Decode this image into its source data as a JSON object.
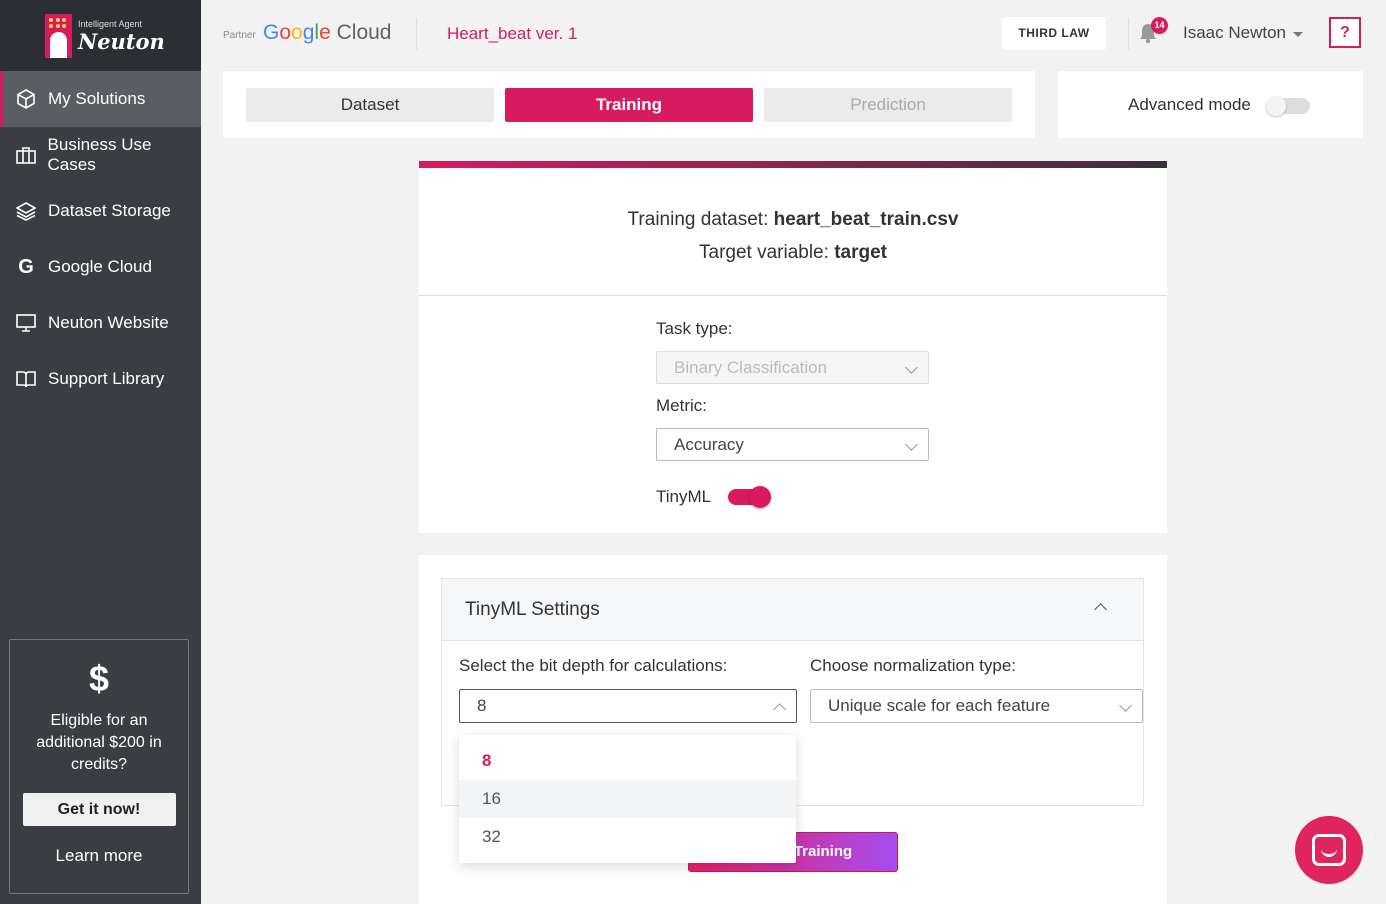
{
  "sidebar": {
    "logo": {
      "subtitle": "Intelligent Agent",
      "name": "Neuton"
    },
    "items": [
      {
        "label": "My Solutions",
        "icon": "cube-icon"
      },
      {
        "label": "Business Use Cases",
        "icon": "briefcase-icon"
      },
      {
        "label": "Dataset Storage",
        "icon": "layers-icon"
      },
      {
        "label": "Google Cloud",
        "icon": "google-g-icon"
      },
      {
        "label": "Neuton Website",
        "icon": "monitor-icon"
      },
      {
        "label": "Support Library",
        "icon": "book-icon"
      }
    ],
    "credit": {
      "symbol": "$",
      "text": "Eligible for an additional $200 in credits?",
      "button": "Get it now!",
      "link": "Learn more"
    }
  },
  "header": {
    "partner": "Partner",
    "brand": {
      "g": "G",
      "o1": "o",
      "o2": "o",
      "g2": "g",
      "l": "l",
      "e": "e",
      "cloud": "Cloud"
    },
    "project_title": "Heart_beat ver. 1",
    "org_button": "THIRD LAW",
    "notifications_count": "14",
    "user_name": "Isaac Newton",
    "help_label": "?"
  },
  "tabs": [
    {
      "label": "Dataset",
      "state": "default"
    },
    {
      "label": "Training",
      "state": "active"
    },
    {
      "label": "Prediction",
      "state": "disabled"
    }
  ],
  "advanced_mode": {
    "label": "Advanced mode",
    "enabled": false
  },
  "training": {
    "dataset_prefix": "Training dataset:",
    "dataset_name": "heart_beat_train.csv",
    "target_prefix": "Target variable:",
    "target_name": "target",
    "task_type_label": "Task type:",
    "task_type_value": "Binary Classification",
    "metric_label": "Metric:",
    "metric_value": "Accuracy",
    "tinyml_label": "TinyML",
    "tinyml_enabled": true
  },
  "tinyml_settings": {
    "title": "TinyML Settings",
    "bit_depth_label": "Select the bit depth for calculations:",
    "bit_depth_value": "8",
    "bit_depth_options": [
      "8",
      "16",
      "32"
    ],
    "normalization_label": "Choose normalization type:",
    "normalization_value": "Unique scale for each feature",
    "start_button": "Training"
  },
  "colors": {
    "accent": "#d81b60",
    "sidebar": "#3a3d42"
  }
}
